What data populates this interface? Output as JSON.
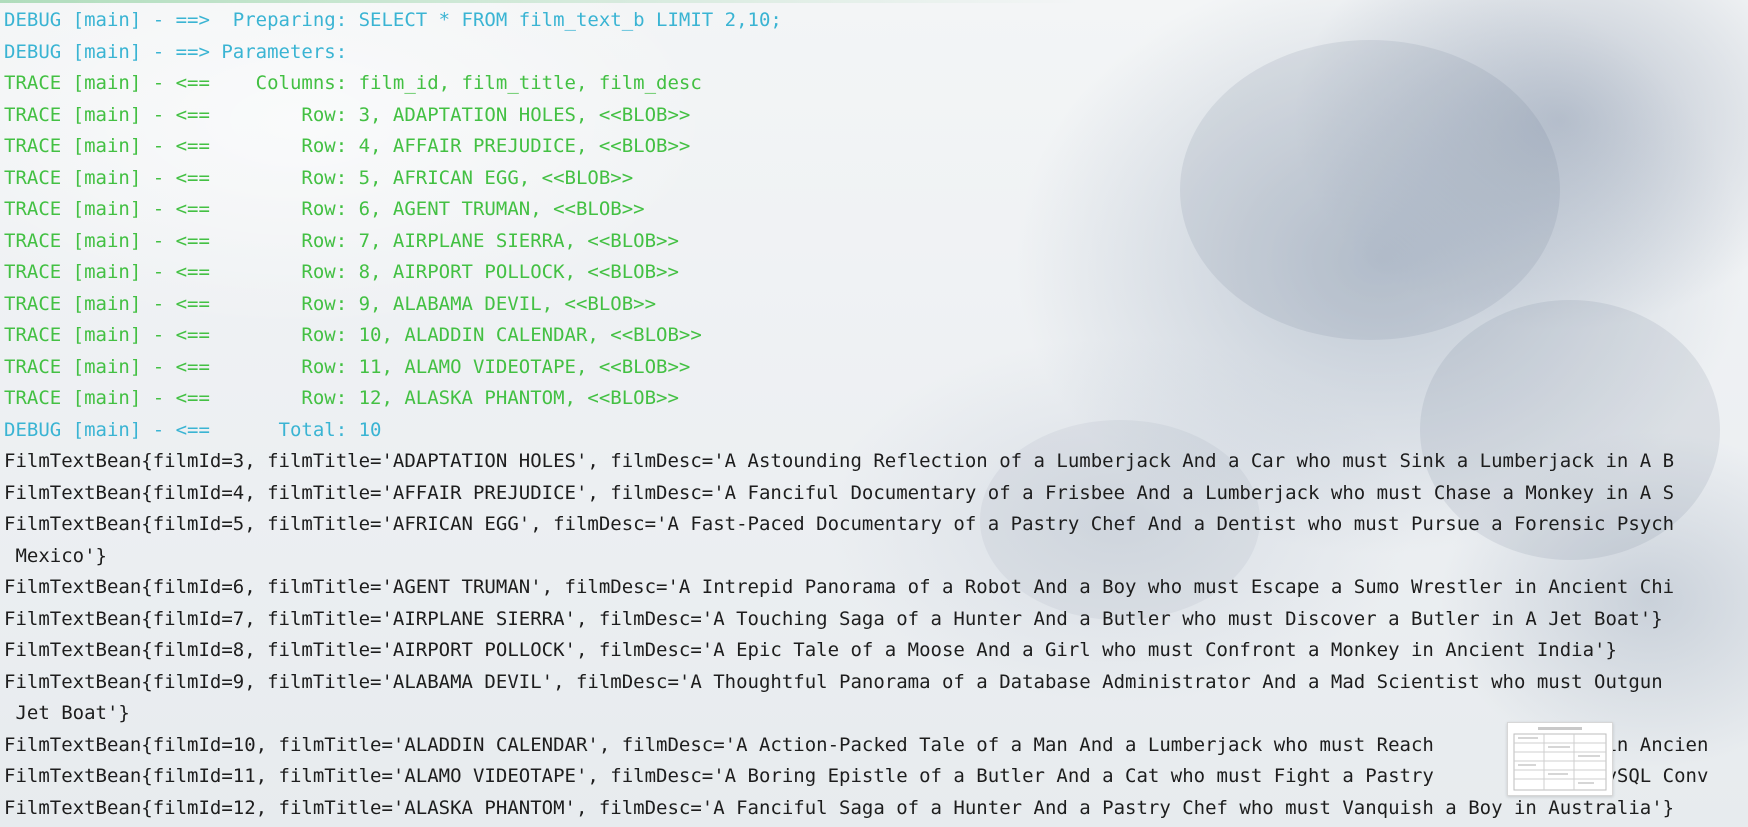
{
  "console": {
    "log_lines": [
      {
        "level": "debug",
        "text": "DEBUG [main] - ==>  Preparing: SELECT * FROM film_text_b LIMIT 2,10;"
      },
      {
        "level": "debug",
        "text": "DEBUG [main] - ==> Parameters: "
      },
      {
        "level": "trace",
        "text": "TRACE [main] - <==    Columns: film_id, film_title, film_desc"
      },
      {
        "level": "trace",
        "text": "TRACE [main] - <==        Row: 3, ADAPTATION HOLES, <<BLOB>>"
      },
      {
        "level": "trace",
        "text": "TRACE [main] - <==        Row: 4, AFFAIR PREJUDICE, <<BLOB>>"
      },
      {
        "level": "trace",
        "text": "TRACE [main] - <==        Row: 5, AFRICAN EGG, <<BLOB>>"
      },
      {
        "level": "trace",
        "text": "TRACE [main] - <==        Row: 6, AGENT TRUMAN, <<BLOB>>"
      },
      {
        "level": "trace",
        "text": "TRACE [main] - <==        Row: 7, AIRPLANE SIERRA, <<BLOB>>"
      },
      {
        "level": "trace",
        "text": "TRACE [main] - <==        Row: 8, AIRPORT POLLOCK, <<BLOB>>"
      },
      {
        "level": "trace",
        "text": "TRACE [main] - <==        Row: 9, ALABAMA DEVIL, <<BLOB>>"
      },
      {
        "level": "trace",
        "text": "TRACE [main] - <==        Row: 10, ALADDIN CALENDAR, <<BLOB>>"
      },
      {
        "level": "trace",
        "text": "TRACE [main] - <==        Row: 11, ALAMO VIDEOTAPE, <<BLOB>>"
      },
      {
        "level": "trace",
        "text": "TRACE [main] - <==        Row: 12, ALASKA PHANTOM, <<BLOB>>"
      },
      {
        "level": "debug",
        "text": "DEBUG [main] - <==      Total: 10"
      }
    ],
    "output_lines": [
      "FilmTextBean{filmId=3, filmTitle='ADAPTATION HOLES', filmDesc='A Astounding Reflection of a Lumberjack And a Car who must Sink a Lumberjack in A B",
      "FilmTextBean{filmId=4, filmTitle='AFFAIR PREJUDICE', filmDesc='A Fanciful Documentary of a Frisbee And a Lumberjack who must Chase a Monkey in A S",
      "FilmTextBean{filmId=5, filmTitle='AFRICAN EGG', filmDesc='A Fast-Paced Documentary of a Pastry Chef And a Dentist who must Pursue a Forensic Psych",
      " Mexico'}",
      "FilmTextBean{filmId=6, filmTitle='AGENT TRUMAN', filmDesc='A Intrepid Panorama of a Robot And a Boy who must Escape a Sumo Wrestler in Ancient Chi",
      "FilmTextBean{filmId=7, filmTitle='AIRPLANE SIERRA', filmDesc='A Touching Saga of a Hunter And a Butler who must Discover a Butler in A Jet Boat'}",
      "FilmTextBean{filmId=8, filmTitle='AIRPORT POLLOCK', filmDesc='A Epic Tale of a Moose And a Girl who must Confront a Monkey in Ancient India'}",
      "FilmTextBean{filmId=9, filmTitle='ALABAMA DEVIL', filmDesc='A Thoughtful Panorama of a Database Administrator And a Mad Scientist who must Outgun",
      " Jet Boat'}",
      "FilmTextBean{filmId=10, filmTitle='ALADDIN CALENDAR', filmDesc='A Action-Packed Tale of a Man And a Lumberjack who must Reach            st in Ancien",
      "FilmTextBean{filmId=11, filmTitle='ALAMO VIDEOTAPE', filmDesc='A Boring Epistle of a Butler And a Cat who must Fight a Pastry            A MySQL Conv",
      "FilmTextBean{filmId=12, filmTitle='ALASKA PHANTOM', filmDesc='A Fanciful Saga of a Hunter And a Pastry Chef who must Vanquish a Boy in Australia'}"
    ]
  },
  "colors": {
    "debug": "#3ab4d3",
    "trace": "#43c043",
    "output": "#1d1d1d"
  },
  "thumbnail": {
    "icon": "document-thumbnail-icon"
  }
}
